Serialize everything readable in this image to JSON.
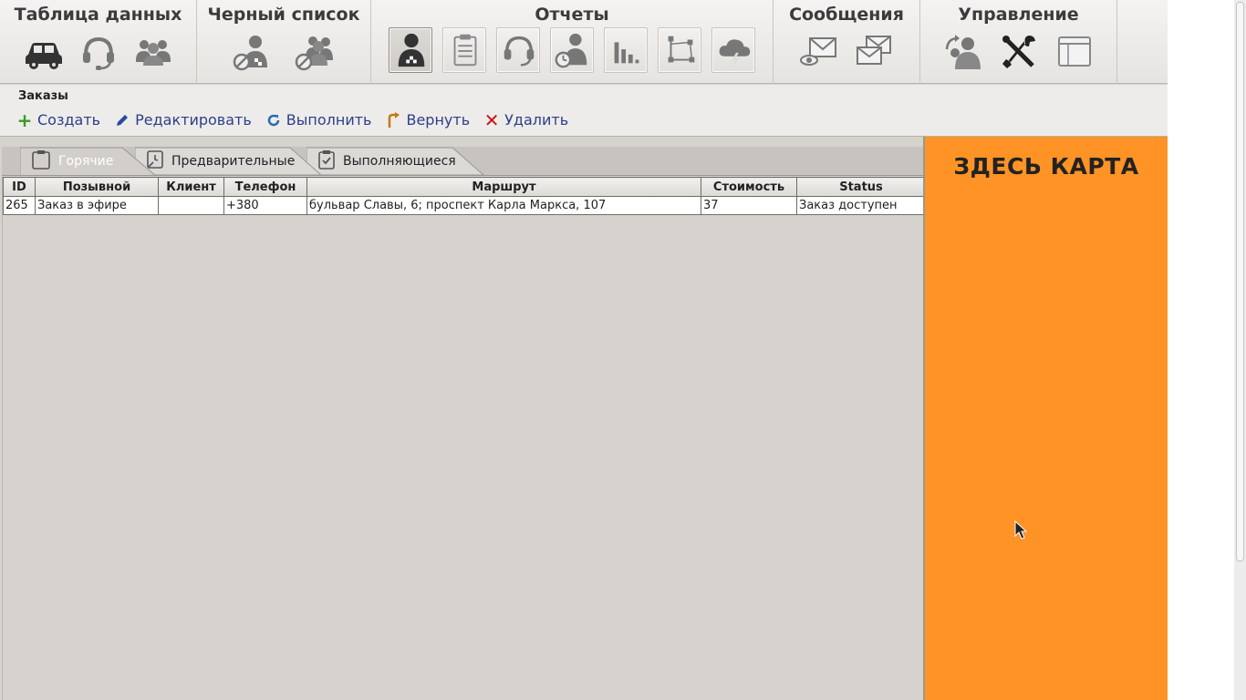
{
  "ribbon": {
    "groups": [
      {
        "title": "Таблица данных",
        "icons": [
          "car-icon",
          "headset-icon",
          "users-group-icon"
        ]
      },
      {
        "title": "Черный список",
        "icons": [
          "blocked-driver-icon",
          "blocked-group-icon"
        ]
      },
      {
        "title": "Отчеты",
        "icons": [
          "driver-report-icon",
          "clipboard-report-icon",
          "operator-report-icon",
          "driver-time-report-icon",
          "bar-chart-icon",
          "route-report-icon",
          "weather-icon"
        ]
      },
      {
        "title": "Сообщения",
        "icons": [
          "view-message-icon",
          "messages-icon"
        ]
      },
      {
        "title": "Управление",
        "icons": [
          "user-switch-icon",
          "tools-icon",
          "window-icon"
        ]
      }
    ]
  },
  "orders": {
    "title": "Заказы",
    "actions": {
      "create": "Создать",
      "edit": "Редактировать",
      "execute": "Выполнить",
      "return": "Вернуть",
      "delete": "Удалить"
    }
  },
  "tabs": {
    "hot": "Горячие",
    "preliminary": "Предварительные",
    "in_progress": "Выполняющиеся",
    "active_tab": "Горячие"
  },
  "table": {
    "columns": {
      "id": "ID",
      "callsign": "Позывной",
      "client": "Клиент",
      "phone": "Телефон",
      "route": "Маршрут",
      "cost": "Стоимость",
      "status": "Status"
    },
    "rows": [
      {
        "id": "265",
        "callsign": "Заказ в эфире",
        "client": "",
        "phone": "+380",
        "route": "бульвар Славы, 6; проспект Карла Маркса, 107",
        "cost": "37",
        "status": "Заказ доступен"
      }
    ]
  },
  "map": {
    "label": "ЗДЕСЬ КАРТА",
    "background_color": "#ff9325"
  },
  "colors": {
    "action_link": "#2c3f87",
    "create_icon": "#3a9a1e",
    "delete_icon": "#c8141a",
    "return_icon": "#c07a16"
  }
}
